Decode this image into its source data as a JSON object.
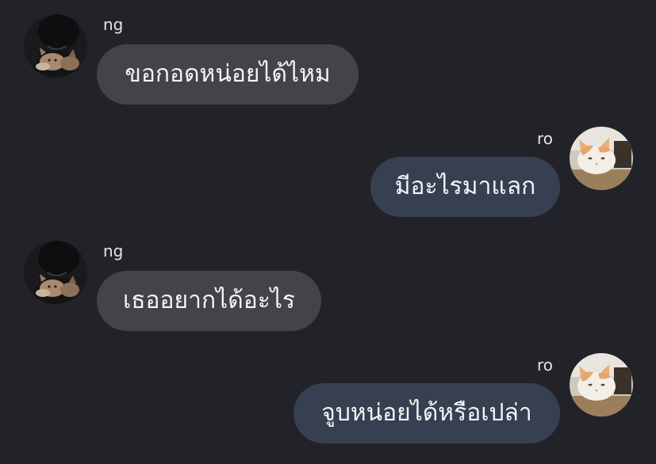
{
  "messages": [
    {
      "sender": "ng",
      "direction": "incoming",
      "avatar": "person-holding-cat-avatar",
      "text": "ขอกอดหน่อยได้ไหม"
    },
    {
      "sender": "ro",
      "direction": "outgoing",
      "avatar": "cat-avatar",
      "text": "มีอะไรมาแลก"
    },
    {
      "sender": "ng",
      "direction": "incoming",
      "avatar": "person-holding-cat-avatar",
      "text": "เธออยากได้อะไร"
    },
    {
      "sender": "ro",
      "direction": "outgoing",
      "avatar": "cat-avatar",
      "text": "จูบหน่อยได้หรือเปล่า"
    }
  ],
  "colors": {
    "background": "#222328",
    "incoming_bubble": "#434449",
    "outgoing_bubble": "#374050",
    "text": "#f3f4f8"
  }
}
